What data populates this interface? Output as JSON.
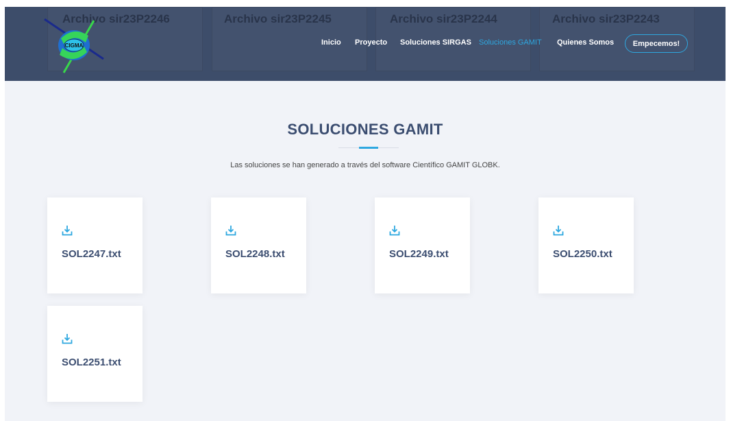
{
  "header": {
    "background_color": "#3d4d6a",
    "ghost_files": [
      "Archivo sir23P2246",
      "Archivo sir23P2245",
      "Archivo sir23P2244",
      "Archivo sir23P2243"
    ],
    "logo_text": "CIGMA",
    "nav": {
      "items": [
        {
          "label": "Inicio",
          "active": false
        },
        {
          "label": "Proyecto",
          "active": false
        },
        {
          "label": "Soluciones SIRGAS",
          "active": false
        },
        {
          "label": "Soluciones GAMIT",
          "active": true
        },
        {
          "label": "Quienes Somos",
          "active": false
        }
      ],
      "cta_label": "Empecemos!"
    },
    "accent_color": "#2ea8e0"
  },
  "section": {
    "title": "SOLUCIONES GAMIT",
    "subtitle": "Las soluciones se han generado a través del software Científico GAMIT GLOBK."
  },
  "files": [
    {
      "name": "SOL2247.txt",
      "icon": "download-icon"
    },
    {
      "name": "SOL2248.txt",
      "icon": "download-icon"
    },
    {
      "name": "SOL2249.txt",
      "icon": "download-icon"
    },
    {
      "name": "SOL2250.txt",
      "icon": "download-icon"
    },
    {
      "name": "SOL2251.txt",
      "icon": "download-icon"
    }
  ]
}
